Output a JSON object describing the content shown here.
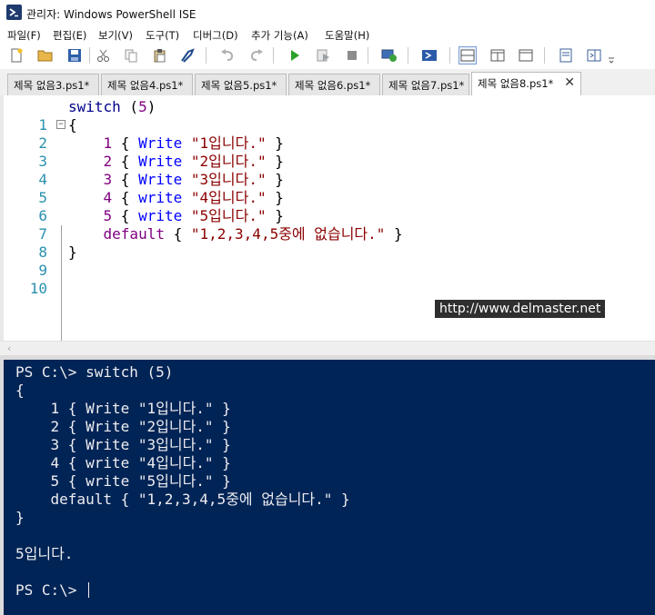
{
  "window": {
    "title": "관리자: Windows PowerShell ISE"
  },
  "menu": [
    "파일(F)",
    "편집(E)",
    "보기(V)",
    "도구(T)",
    "디버그(D)",
    "추가 기능(A)",
    "도움말(H)"
  ],
  "tabs": [
    {
      "label": "제목 없음3.ps1*",
      "active": false
    },
    {
      "label": "제목 없음4.ps1*",
      "active": false
    },
    {
      "label": "제목 없음5.ps1*",
      "active": false
    },
    {
      "label": "제목 없음6.ps1*",
      "active": false
    },
    {
      "label": "제목 없음7.ps1*",
      "active": false
    },
    {
      "label": "제목 없음8.ps1*",
      "active": true
    }
  ],
  "editor": {
    "lines": [
      {
        "num": "1",
        "segs": {
          "a": "switch",
          "b": " (",
          "c": "5",
          "d": ")"
        }
      },
      {
        "num": "2",
        "segs": {
          "a": "{"
        }
      },
      {
        "num": "3",
        "segs": {
          "pre": "    ",
          "num": "1",
          "o": " { ",
          "cmd": "Write",
          "sp": " ",
          "str": "\"1입니다.\"",
          "c": " }"
        }
      },
      {
        "num": "4",
        "segs": {
          "pre": "    ",
          "num": "2",
          "o": " { ",
          "cmd": "Write",
          "sp": " ",
          "str": "\"2입니다.\"",
          "c": " }"
        }
      },
      {
        "num": "5",
        "segs": {
          "pre": "    ",
          "num": "3",
          "o": " { ",
          "cmd": "Write",
          "sp": " ",
          "str": "\"3입니다.\"",
          "c": " }"
        }
      },
      {
        "num": "6",
        "segs": {
          "pre": "    ",
          "num": "4",
          "o": " { ",
          "cmd": "write",
          "sp": " ",
          "str": "\"4입니다.\"",
          "c": " }"
        }
      },
      {
        "num": "7",
        "segs": {
          "pre": "    ",
          "num": "5",
          "o": " { ",
          "cmd": "write",
          "sp": " ",
          "str": "\"5입니다.\"",
          "c": " }"
        }
      },
      {
        "num": "8",
        "segs": {
          "pre": "    ",
          "kw": "default",
          "o": " { ",
          "str": "\"1,2,3,4,5중에 없습니다.\"",
          "c": " }"
        }
      },
      {
        "num": "9",
        "segs": {
          "a": "}"
        }
      },
      {
        "num": "10",
        "segs": {}
      }
    ],
    "watermark": "http://www.delmaster.net"
  },
  "console": {
    "lines": [
      "PS C:\\> switch (5)",
      "{",
      "    1 { Write \"1입니다.\" }",
      "    2 { Write \"2입니다.\" }",
      "    3 { Write \"3입니다.\" }",
      "    4 { write \"4입니다.\" }",
      "    5 { write \"5입니다.\" }",
      "    default { \"1,2,3,4,5중에 없습니다.\" }",
      "}",
      "",
      "5입니다.",
      "",
      "PS C:\\> "
    ]
  },
  "colors": {
    "console_bg": "#012456",
    "console_fg": "#eeedf0",
    "line_number": "#2b91af",
    "keyword": "#00008b",
    "number": "#800080",
    "command": "#0000ff",
    "string": "#8b0000"
  }
}
